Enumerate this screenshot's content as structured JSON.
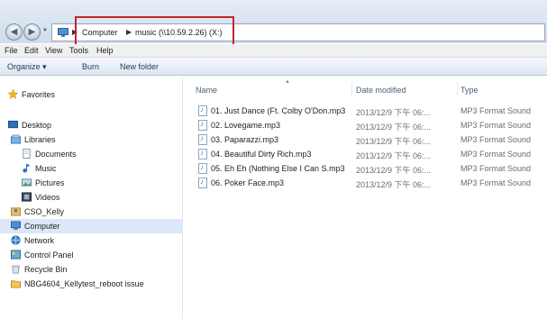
{
  "address": {
    "crumbs": [
      "Computer",
      "music (\\\\10.59.2.26) (X:)"
    ]
  },
  "menu": [
    "File",
    "Edit",
    "View",
    "Tools",
    "Help"
  ],
  "toolbar": {
    "organize": "Organize ▾",
    "burn": "Burn",
    "new_folder": "New folder"
  },
  "nav": [
    {
      "label": "Favorites",
      "icon": "star-icon"
    },
    {
      "label": "Desktop",
      "icon": "desktop-icon"
    },
    {
      "label": "Libraries",
      "icon": "libraries-icon"
    },
    {
      "label": "Documents",
      "icon": "documents-icon"
    },
    {
      "label": "Music",
      "icon": "music-icon"
    },
    {
      "label": "Pictures",
      "icon": "pictures-icon"
    },
    {
      "label": "Videos",
      "icon": "videos-icon"
    },
    {
      "label": "CSO_Kelly",
      "icon": "user-folder-icon"
    },
    {
      "label": "Computer",
      "icon": "computer-icon"
    },
    {
      "label": "Network",
      "icon": "network-icon"
    },
    {
      "label": "Control Panel",
      "icon": "control-panel-icon"
    },
    {
      "label": "Recycle Bin",
      "icon": "recycle-bin-icon"
    },
    {
      "label": "NBG4604_Kellytest_reboot issue",
      "icon": "folder-icon"
    }
  ],
  "columns": {
    "name": "Name",
    "date": "Date modified",
    "type": "Type"
  },
  "files": [
    {
      "name": "01. Just Dance (Ft. Colby O'Don.mp3",
      "date": "2013/12/9 下午 06:...",
      "type": "MP3 Format Sound"
    },
    {
      "name": "02. Lovegame.mp3",
      "date": "2013/12/9 下午 06:...",
      "type": "MP3 Format Sound"
    },
    {
      "name": "03. Paparazzi.mp3",
      "date": "2013/12/9 下午 06:...",
      "type": "MP3 Format Sound"
    },
    {
      "name": "04. Beautiful Dirty Rich.mp3",
      "date": "2013/12/9 下午 06:...",
      "type": "MP3 Format Sound"
    },
    {
      "name": "05. Eh Eh (Nothing Else I Can S.mp3",
      "date": "2013/12/9 下午 06:...",
      "type": "MP3 Format Sound"
    },
    {
      "name": "06. Poker Face.mp3",
      "date": "2013/12/9 下午 06:...",
      "type": "MP3 Format Sound"
    }
  ],
  "colors": {
    "highlight_box": "#c0272d",
    "selected_nav": "#dbe8f7"
  }
}
